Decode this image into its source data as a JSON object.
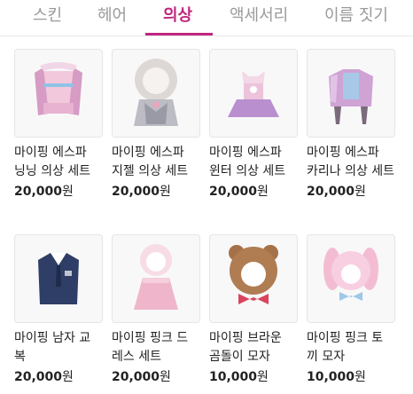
{
  "tabs": [
    {
      "label": "스킨",
      "active": false
    },
    {
      "label": "헤어",
      "active": false
    },
    {
      "label": "의상",
      "active": true
    },
    {
      "label": "액세서리",
      "active": false
    },
    {
      "label": "이름 짓기",
      "active": false
    }
  ],
  "products": [
    {
      "name": "마이핑 에스파\n닝닝 의상 세트",
      "price": "20,000",
      "currency": "원",
      "icon": "pink-jacket-outfit-icon"
    },
    {
      "name": "마이핑 에스파\n지젤 의상 세트",
      "price": "20,000",
      "currency": "원",
      "icon": "fur-hood-silver-outfit-icon"
    },
    {
      "name": "마이핑 에스파\n윈터 의상 세트",
      "price": "20,000",
      "currency": "원",
      "icon": "lavender-dress-outfit-icon"
    },
    {
      "name": "마이핑 에스파\n카리나 의상 세트",
      "price": "20,000",
      "currency": "원",
      "icon": "metallic-jacket-outfit-icon"
    },
    {
      "name": "마이핑 남자 교\n복",
      "price": "20,000",
      "currency": "원",
      "icon": "navy-uniform-outfit-icon"
    },
    {
      "name": "마이핑 핑크 드\n레스 세트",
      "price": "20,000",
      "currency": "원",
      "icon": "pink-dress-set-icon"
    },
    {
      "name": "마이핑 브라운\n곰돌이 모자",
      "price": "10,000",
      "currency": "원",
      "icon": "brown-bear-hat-icon"
    },
    {
      "name": "마이핑 핑크 토\n끼 모자",
      "price": "10,000",
      "currency": "원",
      "icon": "pink-bunny-hat-icon"
    }
  ]
}
